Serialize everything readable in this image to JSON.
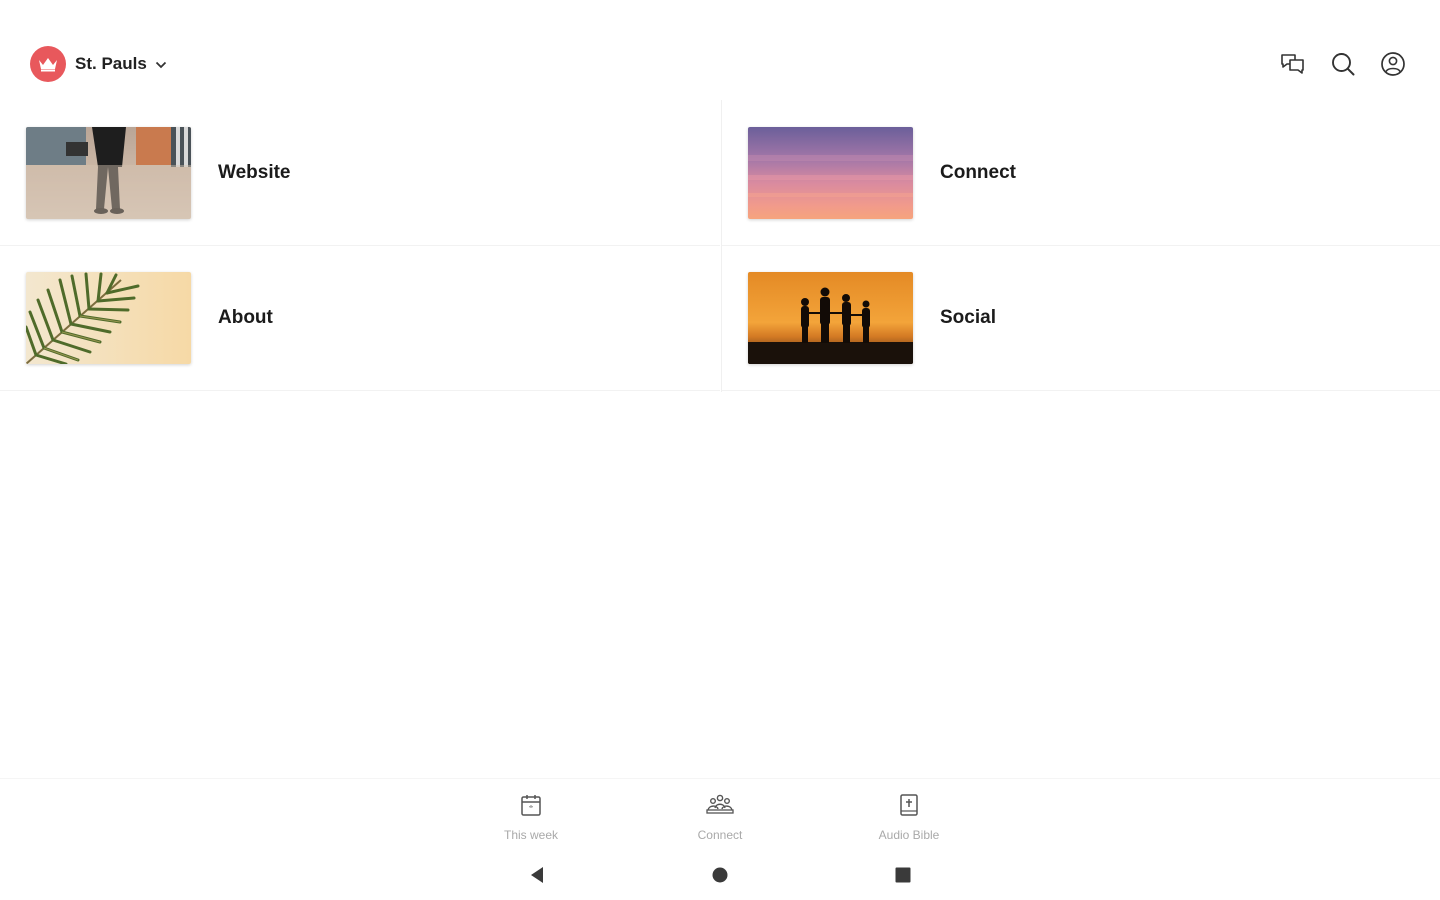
{
  "header": {
    "org_name": "St. Pauls",
    "org_logo_icon": "crown-icon",
    "brand_color": "#e8585c",
    "actions": [
      {
        "icon": "messages-icon"
      },
      {
        "icon": "search-icon"
      },
      {
        "icon": "account-icon"
      }
    ]
  },
  "tiles": [
    {
      "label": "Website",
      "image": "walking-legs-photo"
    },
    {
      "label": "Connect",
      "image": "pink-sunset-sky-photo"
    },
    {
      "label": "About",
      "image": "palm-leaf-photo"
    },
    {
      "label": "Social",
      "image": "family-silhouette-sunset-photo"
    }
  ],
  "bottom_nav": [
    {
      "label": "This week",
      "icon": "calendar-icon"
    },
    {
      "label": "Connect",
      "icon": "people-icon"
    },
    {
      "label": "Audio Bible",
      "icon": "bible-icon"
    }
  ],
  "system_nav": {
    "back_icon": "back-triangle-icon",
    "home_icon": "home-circle-icon",
    "recents_icon": "recents-square-icon"
  }
}
